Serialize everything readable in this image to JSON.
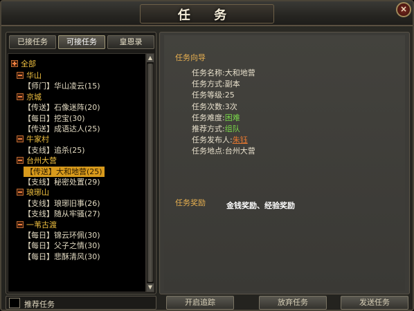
{
  "window": {
    "title": "任 务",
    "close_label": "×"
  },
  "tabs": [
    {
      "label": "已接任务"
    },
    {
      "label": "可接任务"
    },
    {
      "label": "皇恩录"
    }
  ],
  "tree": {
    "all_label": "全部",
    "items": [
      {
        "kind": "cat",
        "label": "华山"
      },
      {
        "kind": "task",
        "label": "【师门】华山凌云(15)"
      },
      {
        "kind": "cat",
        "label": "京城"
      },
      {
        "kind": "task",
        "label": "【传送】石像迷阵(20)"
      },
      {
        "kind": "task",
        "label": "【每日】挖宝(30)"
      },
      {
        "kind": "task",
        "label": "【传送】成语达人(25)"
      },
      {
        "kind": "cat",
        "label": "牛家村"
      },
      {
        "kind": "task",
        "label": "【支线】追杀(25)"
      },
      {
        "kind": "cat",
        "label": "台州大营"
      },
      {
        "kind": "task",
        "label": "【传送】大和地营(25)",
        "selected": true
      },
      {
        "kind": "task",
        "label": "【支线】秘密处置(29)"
      },
      {
        "kind": "cat",
        "label": "琅琊山"
      },
      {
        "kind": "task",
        "label": "【支线】琅琊旧事(26)"
      },
      {
        "kind": "task",
        "label": "【支线】随从牢骚(27)"
      },
      {
        "kind": "cat",
        "label": "一苇古渡"
      },
      {
        "kind": "task",
        "label": "【每日】锦云环佩(30)"
      },
      {
        "kind": "task",
        "label": "【每日】父子之情(30)"
      },
      {
        "kind": "task",
        "label": "【每日】悲酥清风(30)"
      }
    ]
  },
  "recommend_label": "推荐任务",
  "guide": {
    "title": "任务向导",
    "rows": [
      {
        "label": "任务名称:",
        "value": "大和地营",
        "style": "normal"
      },
      {
        "label": "任务方式:",
        "value": "副本",
        "style": "normal"
      },
      {
        "label": "任务等级:",
        "value": "25",
        "style": "normal"
      },
      {
        "label": "任务次数:",
        "value": "3次",
        "style": "normal"
      },
      {
        "label": "任务难度:",
        "value": "困难",
        "style": "green"
      },
      {
        "label": "推荐方式:",
        "value": "组队",
        "style": "green"
      },
      {
        "label": "任务发布人:",
        "value": "朱钰",
        "style": "link"
      },
      {
        "label": "任务地点:",
        "value": "台州大营",
        "style": "normal"
      }
    ]
  },
  "reward": {
    "title": "任务奖励",
    "text": "金钱奖励、经验奖励"
  },
  "buttons": {
    "track": "开启追踪",
    "abandon": "放弃任务",
    "send": "发送任务"
  },
  "colors": {
    "selected_bg": "#d89a1c",
    "category": "#f0c040",
    "section_title": "#e8b050",
    "green_value": "#7ad84a",
    "link_value": "#e87830"
  }
}
